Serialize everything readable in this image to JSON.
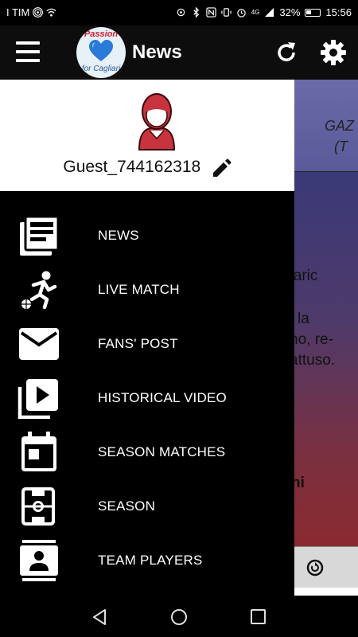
{
  "status_bar": {
    "carrier": "I TIM",
    "battery": "32%",
    "time": "15:56",
    "network": "4G"
  },
  "app_bar": {
    "title": "News",
    "logo_top": "Passion",
    "logo_bottom": "for Cagliari"
  },
  "background": {
    "header_line1": "GAZ",
    "header_line2": "(T",
    "body_lines": [
      "idaric",
      "la",
      "no, re-",
      "attuso.",
      "ni"
    ]
  },
  "drawer": {
    "username": "Guest_744162318",
    "menu": [
      {
        "label": "NEWS",
        "icon": "news-icon"
      },
      {
        "label": "LIVE MATCH",
        "icon": "soccer-player-icon"
      },
      {
        "label": "FANS' POST",
        "icon": "mail-icon"
      },
      {
        "label": "HISTORICAL VIDEO",
        "icon": "video-library-icon"
      },
      {
        "label": "SEASON MATCHES",
        "icon": "calendar-icon"
      },
      {
        "label": "SEASON",
        "icon": "soccer-field-icon"
      },
      {
        "label": "TEAM PLAYERS",
        "icon": "player-card-icon"
      }
    ]
  },
  "colors": {
    "drawer_bg": "#000000",
    "header_bg": "#ffffff",
    "accent_red": "#d11b2c",
    "logo_blue": "#2a7ad8"
  }
}
